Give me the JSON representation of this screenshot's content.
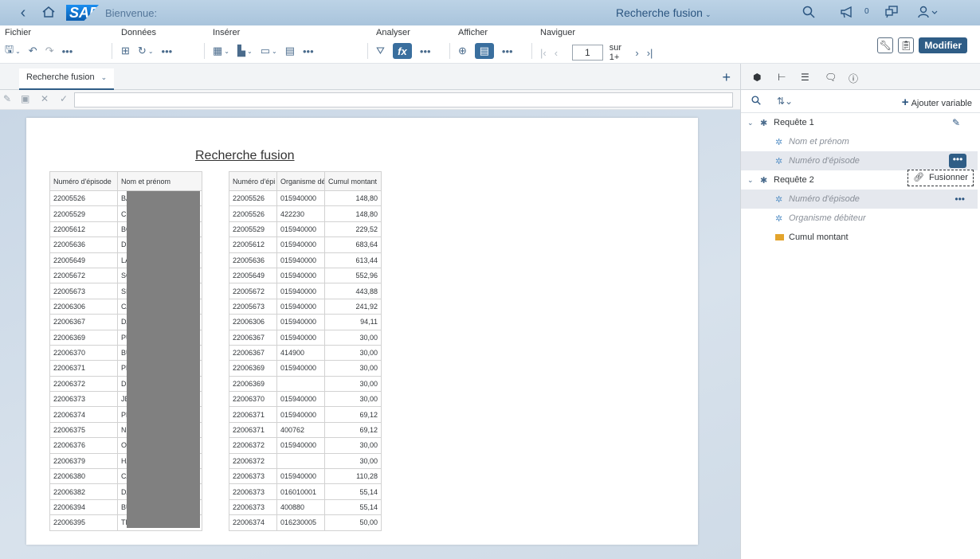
{
  "shell": {
    "welcome": "Bienvenue:",
    "title": "Recherche fusion",
    "notifications_count": "0"
  },
  "toolbar": {
    "groups": {
      "fichier": "Fichier",
      "donnees": "Données",
      "inserer": "Insérer",
      "analyser": "Analyser",
      "afficher": "Afficher",
      "naviguer": "Naviguer"
    },
    "page_value": "1",
    "page_total": "sur 1+",
    "modifier_label": "Modifier"
  },
  "tab": {
    "label": "Recherche fusion"
  },
  "report": {
    "title": "Recherche fusion",
    "table1": {
      "headers": [
        "Numéro d'épisode",
        "Nom et prénom"
      ],
      "rows": [
        [
          "22005526",
          "BA"
        ],
        [
          "22005529",
          "CO"
        ],
        [
          "22005612",
          "BO"
        ],
        [
          "22005636",
          "DU"
        ],
        [
          "22005649",
          "LA"
        ],
        [
          "22005672",
          "SC"
        ],
        [
          "22005673",
          "SI"
        ],
        [
          "22006306",
          "CA"
        ],
        [
          "22006367",
          "DA"
        ],
        [
          "22006369",
          "PU"
        ],
        [
          "22006370",
          "BU"
        ],
        [
          "22006371",
          "PE"
        ],
        [
          "22006372",
          "DE"
        ],
        [
          "22006373",
          "JE"
        ],
        [
          "22006374",
          "PE"
        ],
        [
          "22006375",
          "NC"
        ],
        [
          "22006376",
          "OF"
        ],
        [
          "22006379",
          "HA"
        ],
        [
          "22006380",
          "CA"
        ],
        [
          "22006382",
          "DA"
        ],
        [
          "22006394",
          "BU"
        ],
        [
          "22006395",
          "TR"
        ]
      ]
    },
    "table2": {
      "headers": [
        "Numéro d'épi",
        "Organisme dé",
        "Cumul montant"
      ],
      "rows": [
        [
          "22005526",
          "015940000",
          "148,80"
        ],
        [
          "22005526",
          "422230",
          "148,80"
        ],
        [
          "22005529",
          "015940000",
          "229,52"
        ],
        [
          "22005612",
          "015940000",
          "683,64"
        ],
        [
          "22005636",
          "015940000",
          "613,44"
        ],
        [
          "22005649",
          "015940000",
          "552,96"
        ],
        [
          "22005672",
          "015940000",
          "443,88"
        ],
        [
          "22005673",
          "015940000",
          "241,92"
        ],
        [
          "22006306",
          "015940000",
          "94,11"
        ],
        [
          "22006367",
          "015940000",
          "30,00"
        ],
        [
          "22006367",
          "414900",
          "30,00"
        ],
        [
          "22006369",
          "015940000",
          "30,00"
        ],
        [
          "22006369",
          "",
          "30,00"
        ],
        [
          "22006370",
          "015940000",
          "30,00"
        ],
        [
          "22006371",
          "015940000",
          "69,12"
        ],
        [
          "22006371",
          "400762",
          "69,12"
        ],
        [
          "22006372",
          "015940000",
          "30,00"
        ],
        [
          "22006372",
          "",
          "30,00"
        ],
        [
          "22006373",
          "015940000",
          "110,28"
        ],
        [
          "22006373",
          "016010001",
          "55,14"
        ],
        [
          "22006373",
          "400880",
          "55,14"
        ],
        [
          "22006374",
          "016230005",
          "50,00"
        ]
      ]
    }
  },
  "panel": {
    "add_variable": "Ajouter variable",
    "query1": {
      "label": "Requête 1",
      "objects": [
        "Nom et prénom",
        "Numéro d'épisode"
      ]
    },
    "query2": {
      "label": "Requête 2",
      "objects": [
        "Numéro d'épisode",
        "Organisme débiteur",
        "Cumul montant"
      ]
    },
    "merge_label": "Fusionner"
  }
}
